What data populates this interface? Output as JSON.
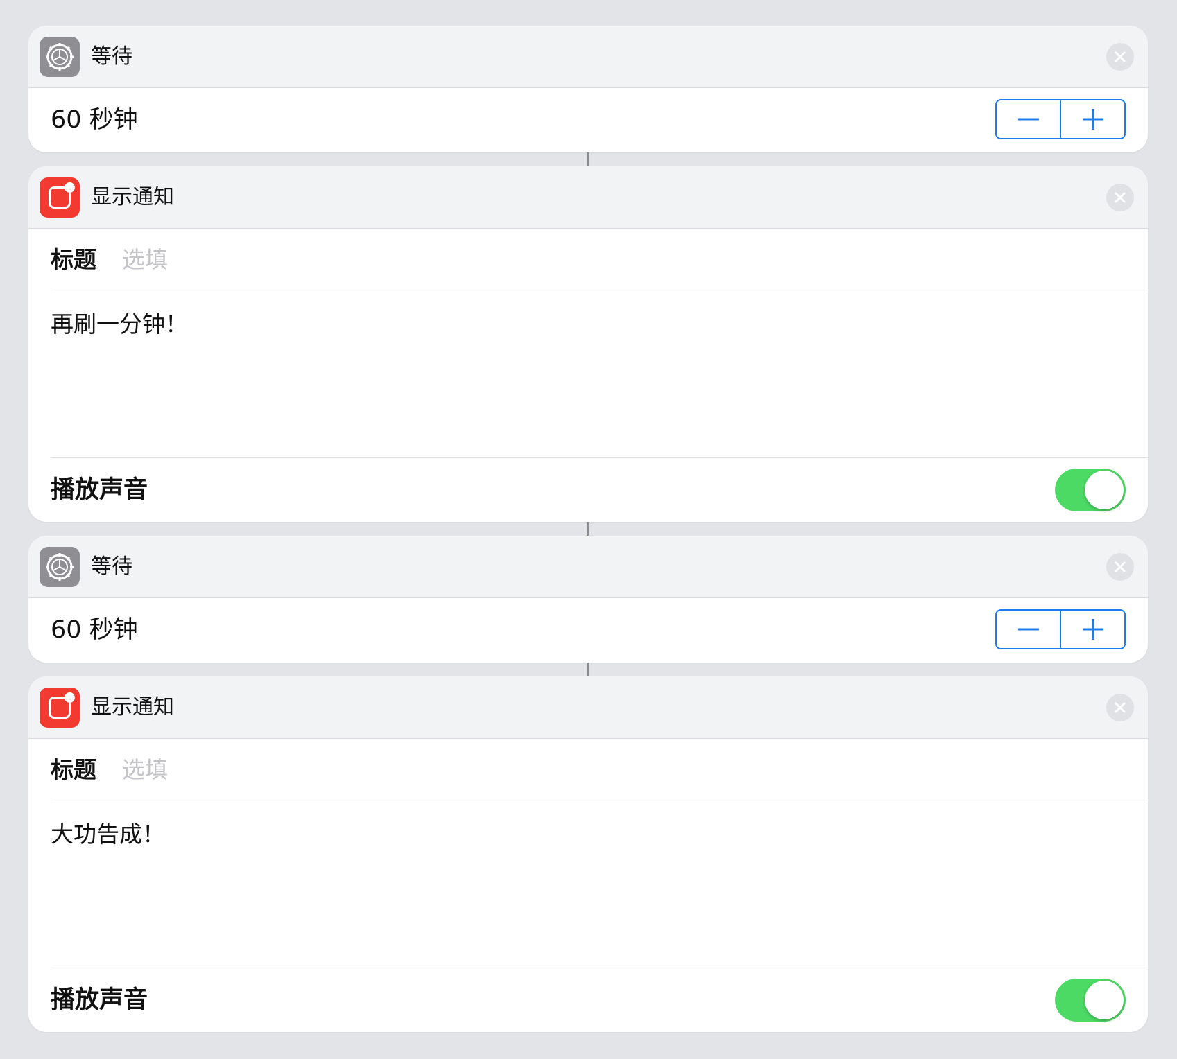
{
  "actions": [
    {
      "type": "wait",
      "header": {
        "title": "等待",
        "icon": "gear-icon"
      },
      "duration": {
        "text": "60 秒钟"
      },
      "stepper": {
        "minus": "minus-icon",
        "plus": "plus-icon"
      }
    },
    {
      "type": "notification",
      "header": {
        "title": "显示通知",
        "icon": "notification-icon"
      },
      "title_field": {
        "label": "标题",
        "placeholder": "选填"
      },
      "body": {
        "text": "再刷一分钟！"
      },
      "sound": {
        "label": "播放声音",
        "enabled": true
      }
    },
    {
      "type": "wait",
      "header": {
        "title": "等待",
        "icon": "gear-icon"
      },
      "duration": {
        "text": "60 秒钟"
      },
      "stepper": {
        "minus": "minus-icon",
        "plus": "plus-icon"
      }
    },
    {
      "type": "notification",
      "header": {
        "title": "显示通知",
        "icon": "notification-icon"
      },
      "title_field": {
        "label": "标题",
        "placeholder": "选填"
      },
      "body": {
        "text": "大功告成！"
      },
      "sound": {
        "label": "播放声音",
        "enabled": true
      }
    }
  ],
  "colors": {
    "background": "#e3e4e8",
    "accent_blue": "#1a7cf0",
    "toggle_on": "#4cd964",
    "notification_red": "#f23a30",
    "settings_gray": "#8e8e93"
  }
}
